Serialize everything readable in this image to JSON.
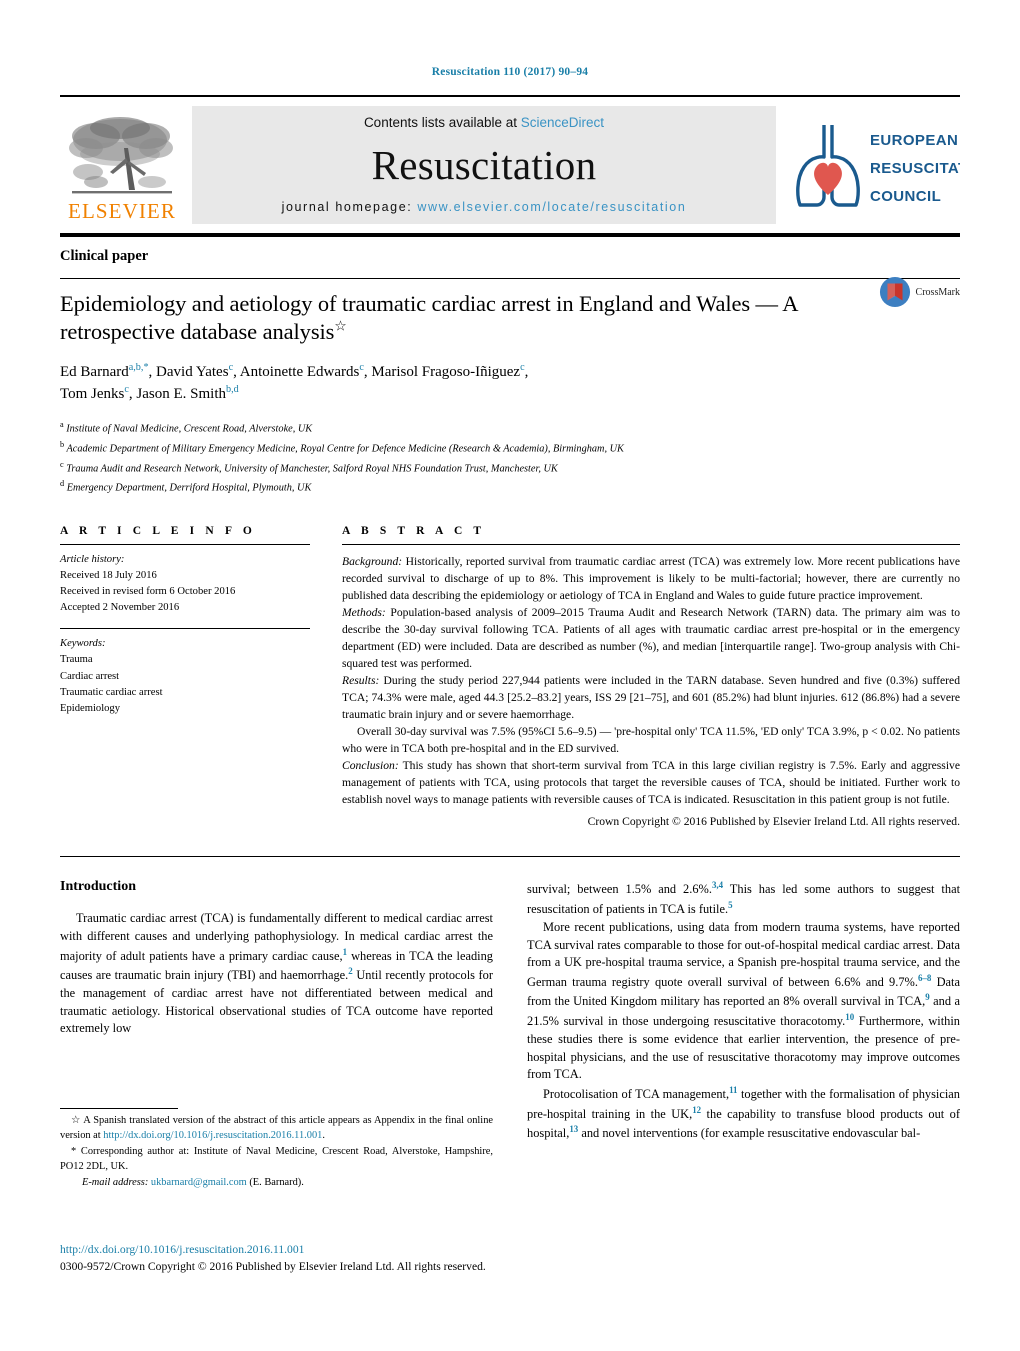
{
  "running_head": "Resuscitation 110 (2017) 90–94",
  "masthead": {
    "elsevier_wordmark": "ELSEVIER",
    "contents_prefix": "Contents lists available at ",
    "contents_link": "ScienceDirect",
    "journal_name": "Resuscitation",
    "homepage_prefix": "journal homepage: ",
    "homepage_url": "www.elsevier.com/locate/resuscitation",
    "erc_line1": "EUROPEAN",
    "erc_line2": "RESUSCITATION",
    "erc_line3": "COUNCIL"
  },
  "article": {
    "kicker": "Clinical paper",
    "title": "Epidemiology and aetiology of traumatic cardiac arrest in England and Wales — A retrospective database analysis",
    "title_star": "☆",
    "crossmark_label": "CrossMark",
    "authors": [
      {
        "name": "Ed Barnard",
        "marks": "a,b,",
        "star": "*",
        "sep": ", "
      },
      {
        "name": "David Yates",
        "marks": "c",
        "star": "",
        "sep": ", "
      },
      {
        "name": "Antoinette Edwards",
        "marks": "c",
        "star": "",
        "sep": ", "
      },
      {
        "name": "Marisol Fragoso-Iñiguez",
        "marks": "c",
        "star": "",
        "sep": ", "
      },
      {
        "name": "Tom Jenks",
        "marks": "c",
        "star": "",
        "sep": ", "
      },
      {
        "name": "Jason E. Smith",
        "marks": "b,d",
        "star": "",
        "sep": ""
      }
    ],
    "affiliations": [
      {
        "mark": "a",
        "text": "Institute of Naval Medicine, Crescent Road, Alverstoke, UK"
      },
      {
        "mark": "b",
        "text": "Academic Department of Military Emergency Medicine, Royal Centre for Defence Medicine (Research & Academia), Birmingham, UK"
      },
      {
        "mark": "c",
        "text": "Trauma Audit and Research Network, University of Manchester, Salford Royal NHS Foundation Trust, Manchester, UK"
      },
      {
        "mark": "d",
        "text": "Emergency Department, Derriford Hospital, Plymouth, UK"
      }
    ]
  },
  "article_info": {
    "header": "A R T I C L E   I N F O",
    "history_label": "Article history:",
    "history": [
      "Received 18 July 2016",
      "Received in revised form 6 October 2016",
      "Accepted 2 November 2016"
    ],
    "keywords_label": "Keywords:",
    "keywords": [
      "Trauma",
      "Cardiac arrest",
      "Traumatic cardiac arrest",
      "Epidemiology"
    ]
  },
  "abstract": {
    "header": "A B S T R A C T",
    "background_label": "Background:",
    "background_text": " Historically, reported survival from traumatic cardiac arrest (TCA) was extremely low. More recent publications have recorded survival to discharge of up to 8%. This improvement is likely to be multi-factorial; however, there are currently no published data describing the epidemiology or aetiology of TCA in England and Wales to guide future practice improvement.",
    "methods_label": "Methods:",
    "methods_text": " Population-based analysis of 2009–2015 Trauma Audit and Research Network (TARN) data. The primary aim was to describe the 30-day survival following TCA. Patients of all ages with traumatic cardiac arrest pre-hospital or in the emergency department (ED) were included. Data are described as number (%), and median [interquartile range]. Two-group analysis with Chi-squared test was performed.",
    "results_label": "Results:",
    "results_text": " During the study period 227,944 patients were included in the TARN database. Seven hundred and five (0.3%) suffered TCA; 74.3% were male, aged 44.3 [25.2–83.2] years, ISS 29 [21–75], and 601 (85.2%) had blunt injuries. 612 (86.8%) had a severe traumatic brain injury and or severe haemorrhage.",
    "results_text2": "Overall 30-day survival was 7.5% (95%CI 5.6–9.5) — 'pre-hospital only' TCA 11.5%, 'ED only' TCA 3.9%, p < 0.02. No patients who were in TCA both pre-hospital and in the ED survived.",
    "conclusion_label": "Conclusion:",
    "conclusion_text": " This study has shown that short-term survival from TCA in this large civilian registry is 7.5%. Early and aggressive management of patients with TCA, using protocols that target the reversible causes of TCA, should be initiated. Further work to establish novel ways to manage patients with reversible causes of TCA is indicated. Resuscitation in this patient group is not futile.",
    "copyright": "Crown Copyright © 2016 Published by Elsevier Ireland Ltd. All rights reserved."
  },
  "introduction": {
    "heading": "Introduction",
    "left_p1_a": "Traumatic cardiac arrest (TCA) is fundamentally different to medical cardiac arrest with different causes and underlying pathophysiology. In medical cardiac arrest the majority of adult patients have a primary cardiac cause,",
    "left_p1_ref1": "1",
    "left_p1_b": " whereas in TCA the leading causes are traumatic brain injury (TBI) and haemorrhage.",
    "left_p1_ref2": "2",
    "left_p1_c": " Until recently protocols for the management of cardiac arrest have not differentiated between medical and traumatic aetiology. Historical observational studies of TCA outcome have reported extremely low",
    "right_p1_a": "survival; between 1.5% and 2.6%.",
    "right_p1_ref1": "3,4",
    "right_p1_b": " This has led some authors to suggest that resuscitation of patients in TCA is futile.",
    "right_p1_ref2": "5",
    "right_p2_a": "More recent publications, using data from modern trauma systems, have reported TCA survival rates comparable to those for out-of-hospital medical cardiac arrest. Data from a UK pre-hospital trauma service, a Spanish pre-hospital trauma service, and the German trauma registry quote overall survival of between 6.6% and 9.7%.",
    "right_p2_ref1": "6–8",
    "right_p2_b": " Data from the United Kingdom military has reported an 8% overall survival in TCA,",
    "right_p2_ref2": "9",
    "right_p2_c": " and a 21.5% survival in those undergoing resuscitative thoracotomy.",
    "right_p2_ref3": "10",
    "right_p2_d": " Furthermore, within these studies there is some evidence that earlier intervention, the presence of pre-hospital physicians, and the use of resuscitative thoracotomy may improve outcomes from TCA.",
    "right_p3_a": "Protocolisation of TCA management,",
    "right_p3_ref1": "11",
    "right_p3_b": " together with the formalisation of physician pre-hospital training in the UK,",
    "right_p3_ref2": "12",
    "right_p3_c": " the capability to transfuse blood products out of hospital,",
    "right_p3_ref3": "13",
    "right_p3_d": " and novel interventions (for example resuscitative endovascular bal-"
  },
  "footnotes": {
    "star_mark": "☆",
    "star_text_a": " A Spanish translated version of the abstract of this article appears as Appendix in the final online version at ",
    "star_link": "http://dx.doi.org/10.1016/j.resuscitation.2016.11.001",
    "star_text_b": ".",
    "corresponding_mark": "*",
    "corresponding_text": " Corresponding author at: Institute of Naval Medicine, Crescent Road, Alverstoke, Hampshire, PO12 2DL, UK.",
    "email_label": "E-mail address:",
    "email_link": "ukbarnard@gmail.com",
    "email_suffix": " (E. Barnard)."
  },
  "bottom": {
    "doi": "http://dx.doi.org/10.1016/j.resuscitation.2016.11.001",
    "issn_line": "0300-9572/Crown Copyright © 2016 Published by Elsevier Ireland Ltd. All rights reserved."
  },
  "colors": {
    "link_blue": "#1a7fa8",
    "sciencedirect_blue": "#3a93c4",
    "elsevier_orange": "#F08100",
    "erc_blue": "#1a5a8e",
    "erc_red": "#E0574F",
    "crossmark_blue": "#3d7fc1",
    "crossmark_red": "#C8352C"
  }
}
